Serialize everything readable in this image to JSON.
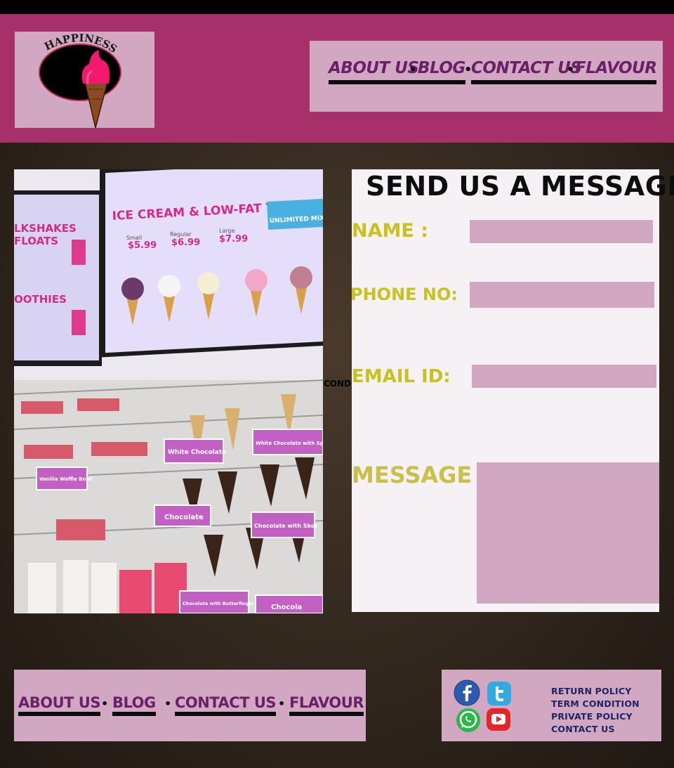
{
  "header": {
    "logo_text": "HAPPINESS",
    "nav": [
      {
        "label": "ABOUT US"
      },
      {
        "label": "BLOG"
      },
      {
        "label": "CONTACT US"
      },
      {
        "label": "FLAVOUR"
      }
    ],
    "separator": "•"
  },
  "photo": {
    "menu_title": "ICE CREAM & LOW-FAT YOGURT",
    "menu_left_1": "LKSHAKES",
    "menu_left_2": "FLOATS",
    "menu_left_3": "OOTHIES",
    "sizes": [
      {
        "name": "Small",
        "price": "$5.99"
      },
      {
        "name": "Regular",
        "price": "$6.99"
      },
      {
        "name": "Large",
        "price": "$7.99"
      }
    ],
    "badge": "UNLIMITED MIX",
    "shelf_labels": [
      "White Chocolate",
      "White Chocolate with Sprinkles",
      "Vanilla Waffle Bowl",
      "Chocolate",
      "Chocolate with Skor",
      "Chocolate with Butterfinger",
      "Chocola"
    ]
  },
  "stray_text": "COND",
  "form": {
    "title": "SEND US A MESSAGE",
    "name_label": "NAME :",
    "phone_label": "PHONE NO:",
    "email_label": "EMAIL ID:",
    "message_label": "MESSAGE :",
    "name_value": "",
    "phone_value": "",
    "email_value": "",
    "message_value": ""
  },
  "footer": {
    "nav": [
      {
        "label": "ABOUT US"
      },
      {
        "label": "BLOG"
      },
      {
        "label": "CONTACT US"
      },
      {
        "label": "FLAVOUR"
      }
    ],
    "separator": "•",
    "social_icons": [
      "facebook-icon",
      "twitter-icon",
      "whatsapp-icon",
      "youtube-icon"
    ],
    "links": [
      "RETURN POLICY",
      "TERM CONDITION",
      "PRIVATE POLICY",
      "CONTACT US"
    ]
  },
  "colors": {
    "header_bg": "#a72f6a",
    "box_bg": "#d2a7c2",
    "nav_text": "#6a1f68",
    "label_yellow": "#c9c21e",
    "footer_link": "#1d2466"
  }
}
